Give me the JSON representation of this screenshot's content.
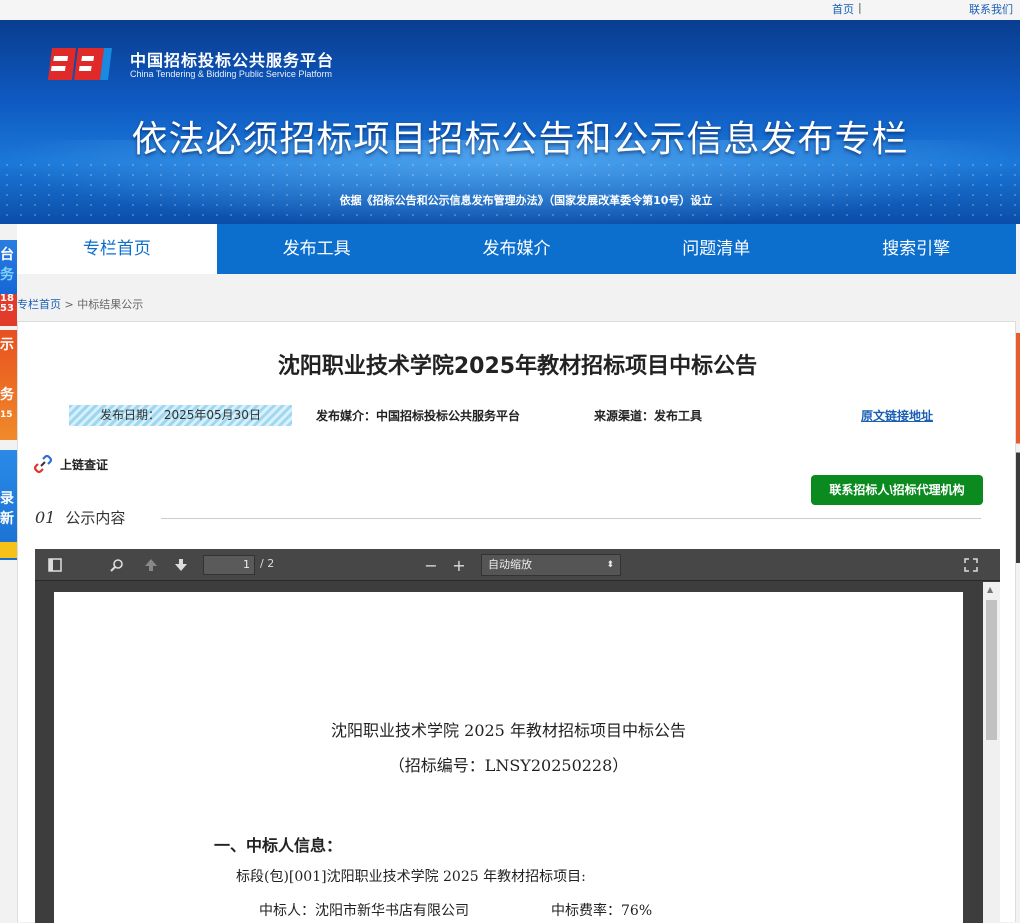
{
  "topbar": {
    "home": "首页",
    "separator": "|",
    "contact": "联系我们"
  },
  "banner": {
    "platform_cn": "中国招标投标公共服务平台",
    "platform_en": "China Tendering & Bidding Public Service Platform",
    "headline": "依法必须招标项目招标公告和公示信息发布专栏",
    "basis": "依据《招标公告和公示信息发布管理办法》（国家发展改革委令第10号）设立"
  },
  "left_ads": {
    "ad1_top": "台",
    "ad1_mid": "务",
    "ad1_red": "18 53",
    "ad2_top": "示",
    "ad2_mid": "务",
    "ad2_bottom": "15",
    "ad3_top": "录",
    "ad3_mid": "新"
  },
  "nav": {
    "items": [
      "专栏首页",
      "发布工具",
      "发布媒介",
      "问题清单",
      "搜索引擎"
    ],
    "active": 0
  },
  "breadcrumb": {
    "home": "专栏首页",
    "arrow": ">",
    "current": "中标结果公示"
  },
  "article": {
    "title": "沈阳职业技术学院2025年教材招标项目中标公告",
    "date": "发布日期： 2025年05月30日",
    "media": "发布媒介：中国招标投标公共服务平台",
    "source": "来源渠道：发布工具",
    "origin_link": "原文链接地址",
    "chain_label": "上链查证",
    "contact_button": "联系招标人\\招标代理机构",
    "section_num": "01",
    "section_label": "公示内容"
  },
  "pdf_viewer": {
    "page_current": "1",
    "page_count": "/ 2",
    "zoom": "自动缩放",
    "doc": {
      "title": "沈阳职业技术学院 2025 年教材招标项目中标公告",
      "code": "（招标编号：LNSY20250228）",
      "heading": "一、中标人信息：",
      "lot": "标段(包)[001]沈阳职业技术学院 2025 年教材招标项目:",
      "winner": "中标人：沈阳市新华书店有限公司",
      "rate": "中标费率：76%"
    }
  },
  "colors": {
    "nav_blue": "#0c6fce",
    "button_green": "#0a8a1f",
    "link_blue": "#1a5fb4"
  }
}
